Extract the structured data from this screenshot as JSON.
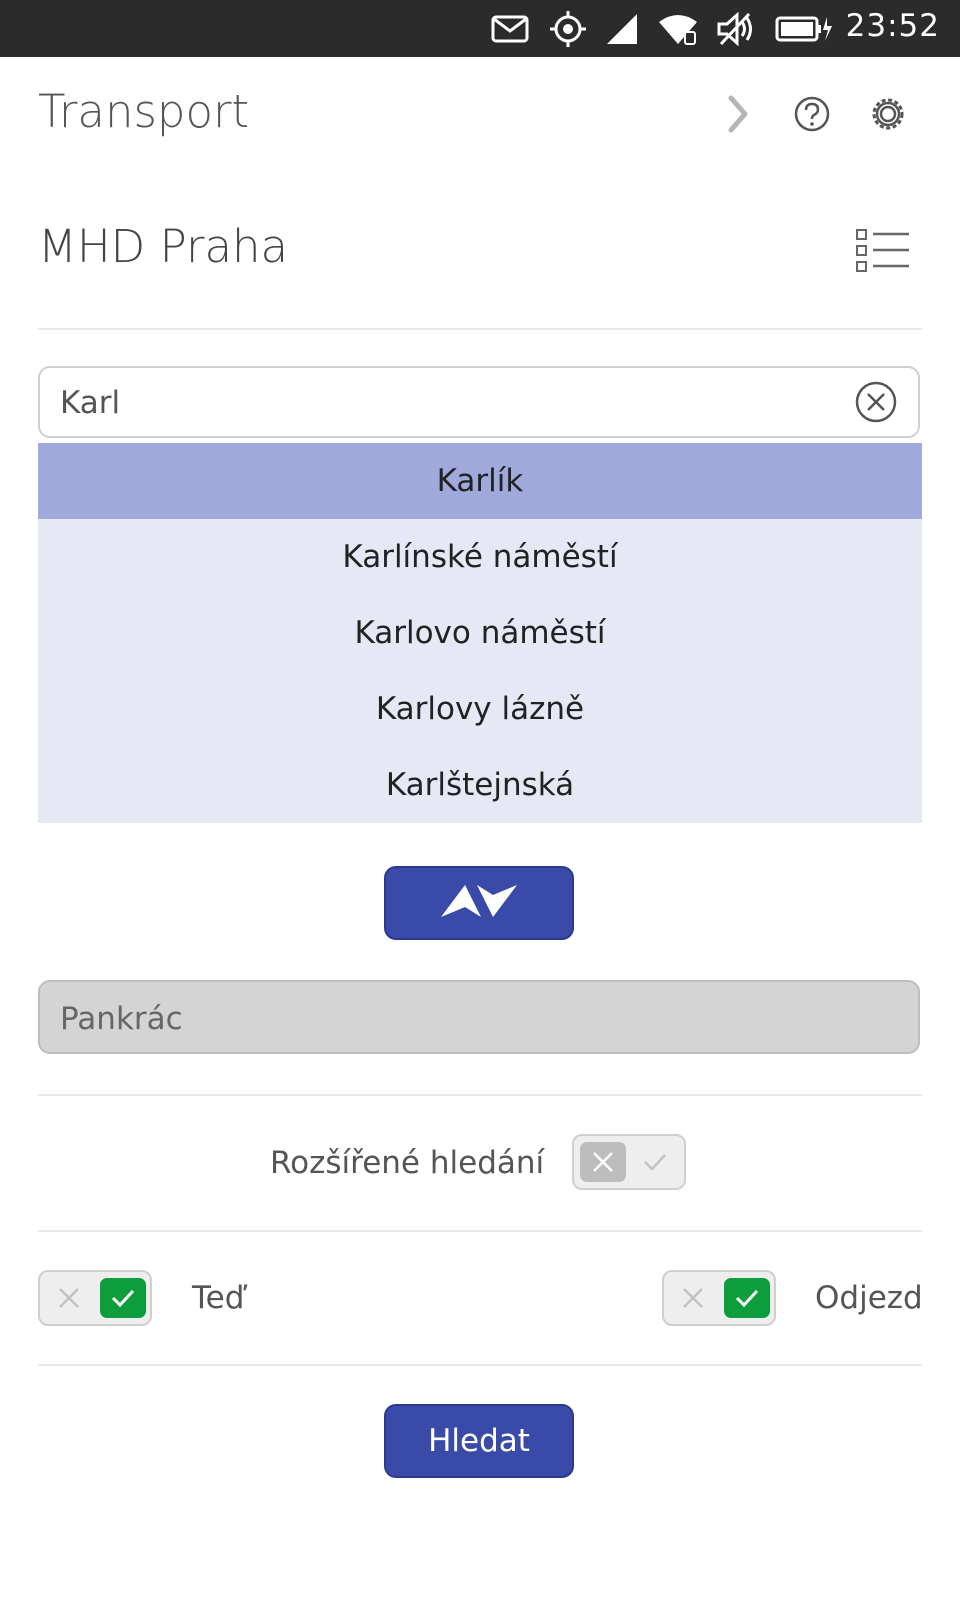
{
  "status_bar": {
    "time": "23:52",
    "icons": [
      "mail-icon",
      "location-icon",
      "signal-icon",
      "wifi-icon",
      "mute-icon",
      "battery-charging-icon"
    ]
  },
  "header": {
    "title": "Transport",
    "icons": [
      "chevron-right-icon",
      "help-icon",
      "settings-icon"
    ]
  },
  "section": {
    "title": "MHD Praha",
    "icon": "list-icon"
  },
  "from_field": {
    "value": "Karl",
    "icon": "clear-icon"
  },
  "suggestions": [
    {
      "label": "Karlík",
      "highlighted": true
    },
    {
      "label": "Karlínské náměstí",
      "highlighted": false
    },
    {
      "label": "Karlovo náměstí",
      "highlighted": false
    },
    {
      "label": "Karlovy lázně",
      "highlighted": false
    },
    {
      "label": "Karlštejnská",
      "highlighted": false
    }
  ],
  "swap_button": {
    "icon": "swap-icon"
  },
  "to_field": {
    "value": "Pankrác"
  },
  "advanced_search": {
    "label": "Rozšířené hledání",
    "enabled": false
  },
  "now_toggle": {
    "label": "Teď",
    "enabled": true
  },
  "departure_toggle": {
    "label": "Odjezd",
    "enabled": true
  },
  "search_button": {
    "label": "Hledat"
  },
  "colors": {
    "accent": "#3a4aa9",
    "suggestion_bg": "#e6e9f5",
    "suggestion_active_bg": "#9fa9db",
    "toggle_on": "#0e9d3c",
    "status_bar_bg": "#2b2b2b"
  }
}
